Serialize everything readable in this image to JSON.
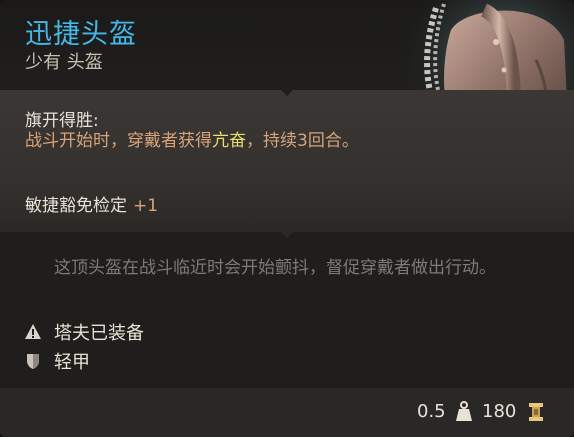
{
  "item": {
    "name": "迅捷头盔",
    "subtitle": "少有 头盔",
    "art_icon": "helmet-icon"
  },
  "passive": {
    "name": "旗开得胜:",
    "desc_before": "战斗开始时，穿戴者获得",
    "desc_highlight": "亢奋",
    "desc_after": "，持续3回合。"
  },
  "bonus": {
    "label": "敏捷豁免检定",
    "value": "+1"
  },
  "flavor_text": "这顶头盔在战斗临近时会开始颤抖，督促穿戴者做出行动。",
  "equipped": {
    "icon": "warning-triangle-icon",
    "label": "塔夫已装备"
  },
  "armor_type": {
    "icon": "shield-icon",
    "label": "轻甲"
  },
  "footer": {
    "weight": "0.5",
    "weight_icon": "weight-icon",
    "price": "180",
    "price_icon": "gold-coin-icon"
  },
  "colors": {
    "title": "#45b7e8",
    "passive_text": "#d9a47a",
    "highlight": "#e9e16d",
    "flavor": "#7e7a74"
  }
}
